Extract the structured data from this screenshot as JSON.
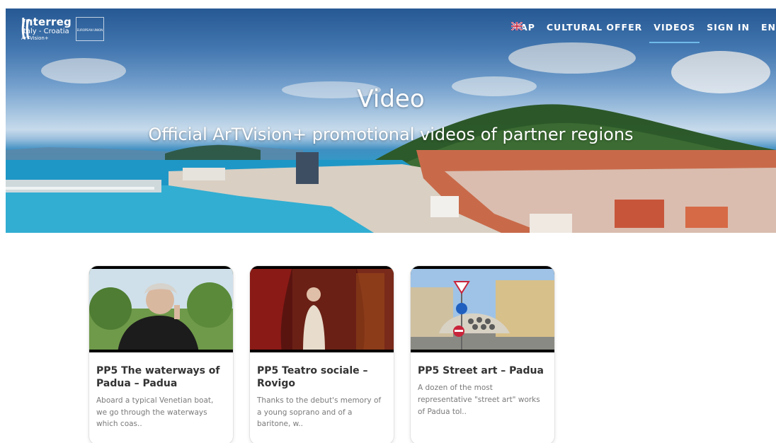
{
  "brand": {
    "title": "Interreg",
    "subtitle": "Italy - Croatia",
    "program": "ArTVision+",
    "eu_label": "EUROPEAN UNION"
  },
  "nav": {
    "items": [
      {
        "label": "MAP",
        "active": false
      },
      {
        "label": "CULTURAL OFFER",
        "active": false
      },
      {
        "label": "VIDEOS",
        "active": true
      },
      {
        "label": "SIGN IN",
        "active": false
      }
    ],
    "language": "EN"
  },
  "hero": {
    "title": "Video",
    "subtitle": "Official ArTVision+ promotional videos of partner regions"
  },
  "cards": [
    {
      "title": "PP5 The waterways of Padua – Padua",
      "description": "Aboard a typical Venetian boat, we go through the waterways which coas.."
    },
    {
      "title": "PP5 Teatro sociale – Rovigo",
      "description": "Thanks to the debut's memory of a young soprano and of a baritone, w.."
    },
    {
      "title": "PP5 Street art – Padua",
      "description": "A dozen of the most representative \"street art\" works of Padua tol.."
    }
  ],
  "colors": {
    "nav_active_underline": "#6fb9e8",
    "card_title": "#333333",
    "card_desc": "#7a7a7a"
  }
}
